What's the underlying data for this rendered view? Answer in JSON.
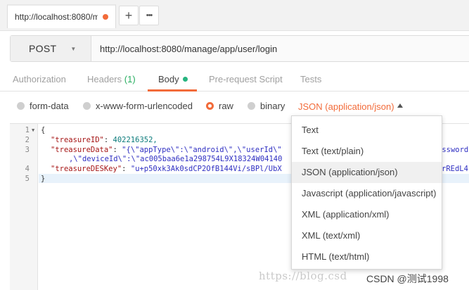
{
  "tab": {
    "title": "http://localhost:8080/ma",
    "modified_color": "#f26b3a"
  },
  "tab_actions": {
    "new_tab": "+",
    "more": "•••"
  },
  "request": {
    "method": "POST",
    "url": "http://localhost:8080/manage/app/user/login"
  },
  "subtabs": {
    "authorization": "Authorization",
    "headers": "Headers",
    "headers_count": "(1)",
    "body": "Body",
    "prerequest": "Pre-request Script",
    "tests": "Tests"
  },
  "body_types": {
    "form_data": "form-data",
    "urlencoded": "x-www-form-urlencoded",
    "raw": "raw",
    "binary": "binary",
    "selected": "raw",
    "content_type": "JSON (application/json)"
  },
  "editor": {
    "line_numbers": [
      "1",
      "2",
      "3",
      "",
      "4",
      "5"
    ],
    "line1": "{",
    "line2_key": "\"treasureID\"",
    "line2_val": "402216352,",
    "line3_key": "\"treasureData\"",
    "line3_val": "\"{\\\"appType\\\":\\\"android\\\",\\\"userId\\\"",
    "line3_tail": "assword",
    "line3b": ",\\\"deviceId\\\":\\\"ac005baa6e1a298754L9X18324W04140",
    "line4_key": "\"treasureDESKey\"",
    "line4_val": "\"u+p50xk3Ak0sdCP2OfB144Vi/sBPl/UbX",
    "line4_tail": "rREdL4",
    "line5": "}"
  },
  "content_type_menu": {
    "items": [
      "Text",
      "Text (text/plain)",
      "JSON (application/json)",
      "Javascript (application/javascript)",
      "XML (application/xml)",
      "XML (text/xml)",
      "HTML (text/html)"
    ],
    "selected": "JSON (application/json)"
  },
  "watermark": "https://blog.csd",
  "attribution": "CSDN @测试1998",
  "colors": {
    "accent": "#f26b3a",
    "active_dot": "#26b47f",
    "headers_count": "#27ae60"
  }
}
